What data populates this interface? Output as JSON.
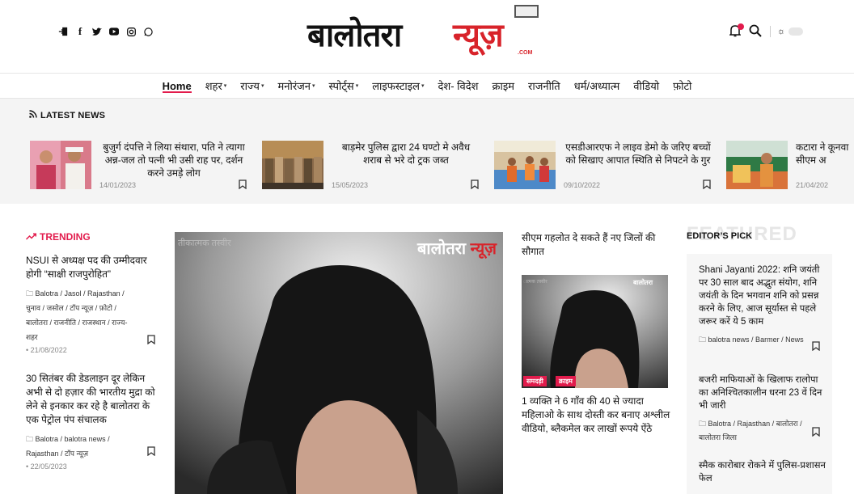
{
  "header": {
    "logo_part1": "बालोतरा",
    "logo_part2": "न्यूज़",
    "logo_com": ".COM",
    "social_icons": [
      "login-icon",
      "facebook-icon",
      "twitter-icon",
      "youtube-icon",
      "instagram-icon",
      "whatsapp-icon"
    ],
    "right_icons": [
      "bell-icon",
      "search-icon",
      "theme-toggle"
    ]
  },
  "nav": {
    "items": [
      {
        "label": "Home",
        "active": true,
        "dropdown": false
      },
      {
        "label": "शहर",
        "dropdown": true
      },
      {
        "label": "राज्य",
        "dropdown": true
      },
      {
        "label": "मनोरंजन",
        "dropdown": true
      },
      {
        "label": "स्पोर्ट्स",
        "dropdown": true
      },
      {
        "label": "लाइफस्टाइल",
        "dropdown": true
      },
      {
        "label": "देश- विदेश",
        "dropdown": false
      },
      {
        "label": "क्राइम",
        "dropdown": false
      },
      {
        "label": "राजनीति",
        "dropdown": false
      },
      {
        "label": "धर्म/अध्यात्म",
        "dropdown": false
      },
      {
        "label": "वीडियो",
        "dropdown": false
      },
      {
        "label": "फ़ोटो",
        "dropdown": false
      }
    ]
  },
  "latest": {
    "heading": "LATEST NEWS",
    "items": [
      {
        "title": "बुजुर्ग दंपत्ति ने लिया संथारा, पति ने त्यागा अन्न-जल तो पत्नी भी उसी राह पर, दर्शन करने उमड़े लोग",
        "date": "14/01/2023"
      },
      {
        "title": "बाड़मेर पुलिस द्वारा 24 घण्टो मे अवैध शराब से भरे दो ट्रक जब्त",
        "date": "15/05/2023"
      },
      {
        "title": "एसडीआरएफ ने लाइव डेमो के जरिए बच्चों को सिखाए आपात स्थिति से निपटने के गुर",
        "date": "09/10/2022"
      },
      {
        "title": "कटारा ने कूनवा सीएम अ",
        "date": "21/04/202"
      }
    ]
  },
  "trending": {
    "heading": "TRENDING",
    "items": [
      {
        "title": "NSUI से अध्यक्ष पद की उम्मीदवार होगी “साक्षी राजपुरोहित”",
        "tags": "Balotra / Jasol / Rajasthan / चुनाव / जसोल / टॉप न्यूज़ / फ़ोटो / बालोतरा / राजनीति / राजस्थान / राज्य-शहर",
        "date": "21/08/2022"
      },
      {
        "title": "30 सितंबर की डेडलाइन दूर लेकिन अभी से दो हज़ार की भारतीय मुद्रा को लेने से इनकार कर रहे है बालोतरा के एक पेट्रोल पंप संचालक",
        "tags": "Balotra / balotra news / Rajasthan / टॉप न्यूज़",
        "date": "22/05/2023"
      }
    ]
  },
  "feature": {
    "watermark": "तीकात्मक तस्वीर",
    "logo_part1": "बालोतरा",
    "logo_part2": "न्यूज़"
  },
  "middle": {
    "title1": "सीएम गहलोत दे सकते हैं नए जिलों की सौगात",
    "img_watermark": "ात्मक तस्वीर",
    "img_logo": "बालोतरा",
    "tags": [
      "समदड़ी",
      "क्राइम"
    ],
    "title2": "1 व्यक्ति ने 6 गाँव की 40 से ज्यादा महिलाओ के साथ दोस्ती कर बनाए अश्लील वीडियो, ब्लैकमेल कर लाखों रूपये ऐंठे"
  },
  "editor": {
    "ghost": "FEATURED",
    "heading": "EDITOR’S PICK",
    "items": [
      {
        "title": "Shani Jayanti 2022: शनि जयंती पर 30 साल बाद अद्भुत संयोग, शनि जयंती के दिन भगवान शनि को प्रसन्न करने के लिए, आज सूर्यास्त से पहले जरूर करें ये 5 काम",
        "tags": "balotra news / Barmer / News"
      },
      {
        "title": "बजरी माफियाओं के खिलाफ रालोपा का अनिश्चितकालीन धरना 23 वें दिन भी जारी",
        "tags": "Balotra / Rajasthan / बालोतरा / बालोतरा जिला"
      },
      {
        "title": "स्मैक कारोबार रोकने में पुलिस-प्रशासन फेल",
        "tags": ""
      }
    ]
  },
  "colors": {
    "accent": "#e21b4c",
    "brand_red": "#d8232a"
  }
}
